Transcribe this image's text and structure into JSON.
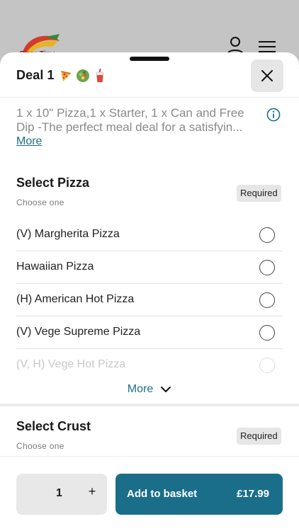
{
  "background": {
    "logo_text": "Pizza Time"
  },
  "deal": {
    "title": "Deal 1",
    "emojis": [
      "pizza-emoji",
      "salad-emoji",
      "drink-emoji"
    ],
    "description_line1": "1 x 10\" Pizza,1 x Starter, 1 x Can and Free",
    "description_line2": "Dip -The perfect meal deal for a satisfyin...",
    "more_link": "More"
  },
  "select_pizza": {
    "title": "Select Pizza",
    "subtitle": "Choose one",
    "badge": "Required",
    "options": [
      "(V) Margherita Pizza",
      "Hawaiian Pizza",
      "(H) American Hot Pizza",
      "(V) Vege Supreme Pizza",
      "(V, H) Vege Hot Pizza"
    ],
    "more_label": "More"
  },
  "select_crust": {
    "title": "Select Crust",
    "subtitle": "Choose one",
    "badge": "Required"
  },
  "footer": {
    "quantity": "1",
    "plus": "+",
    "add_label": "Add to basket",
    "price": "£17.99"
  },
  "colors": {
    "accent": "#1b6e8a",
    "link": "#1d6f88"
  }
}
